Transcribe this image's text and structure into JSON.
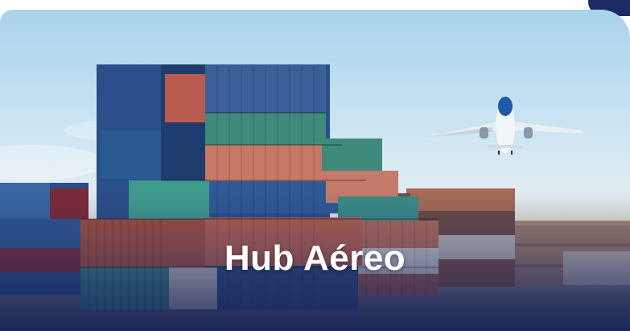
{
  "card": {
    "title": "Hub Aéreo"
  },
  "colors": {
    "brand_navy": "#1d2a64",
    "overlay": "#182258",
    "sky": "#a9d3ec"
  },
  "icons": {
    "scene_image": "container-yard-with-airplane-photo"
  }
}
